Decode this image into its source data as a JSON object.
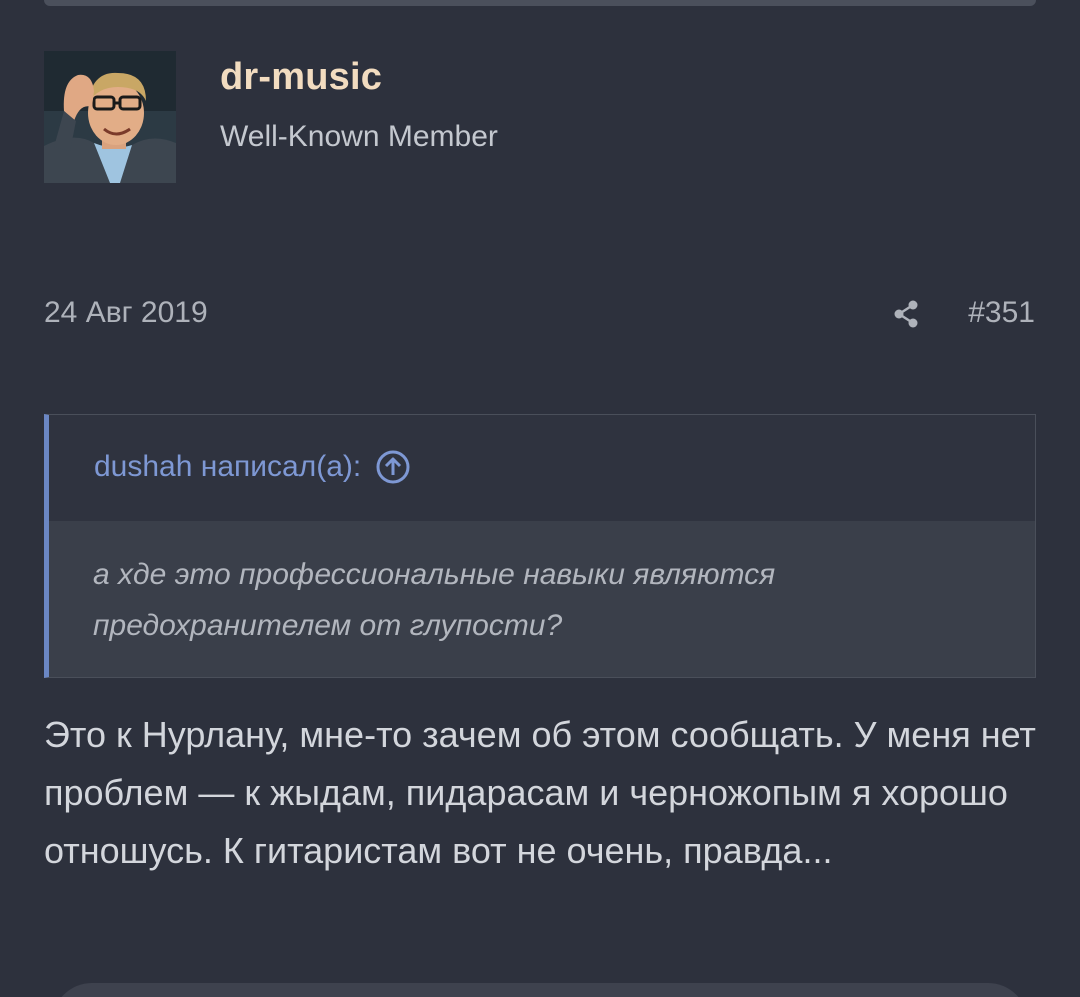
{
  "post": {
    "username": "dr-music",
    "user_title": "Well-Known Member",
    "date": "24 Авг 2019",
    "number": "#351",
    "share_icon": "share-icon"
  },
  "quote": {
    "author_line": "dushah написал(а):",
    "goto_icon": "arrow-up-circle-icon",
    "text": "а хде это профессиональные навыки являются предохранителем от глупости?"
  },
  "message": {
    "text": "Это к Нурлану, мне-то зачем об этом сообщать. У меня нет проблем — к жыдам, пидарасам и черножопым я хорошо отношусь. К гитаристам вот не очень, правда..."
  },
  "colors": {
    "background": "#2d313d",
    "username": "#f2dcc0",
    "quote_accent": "#6b87c4",
    "quote_link": "#7e98d4"
  }
}
